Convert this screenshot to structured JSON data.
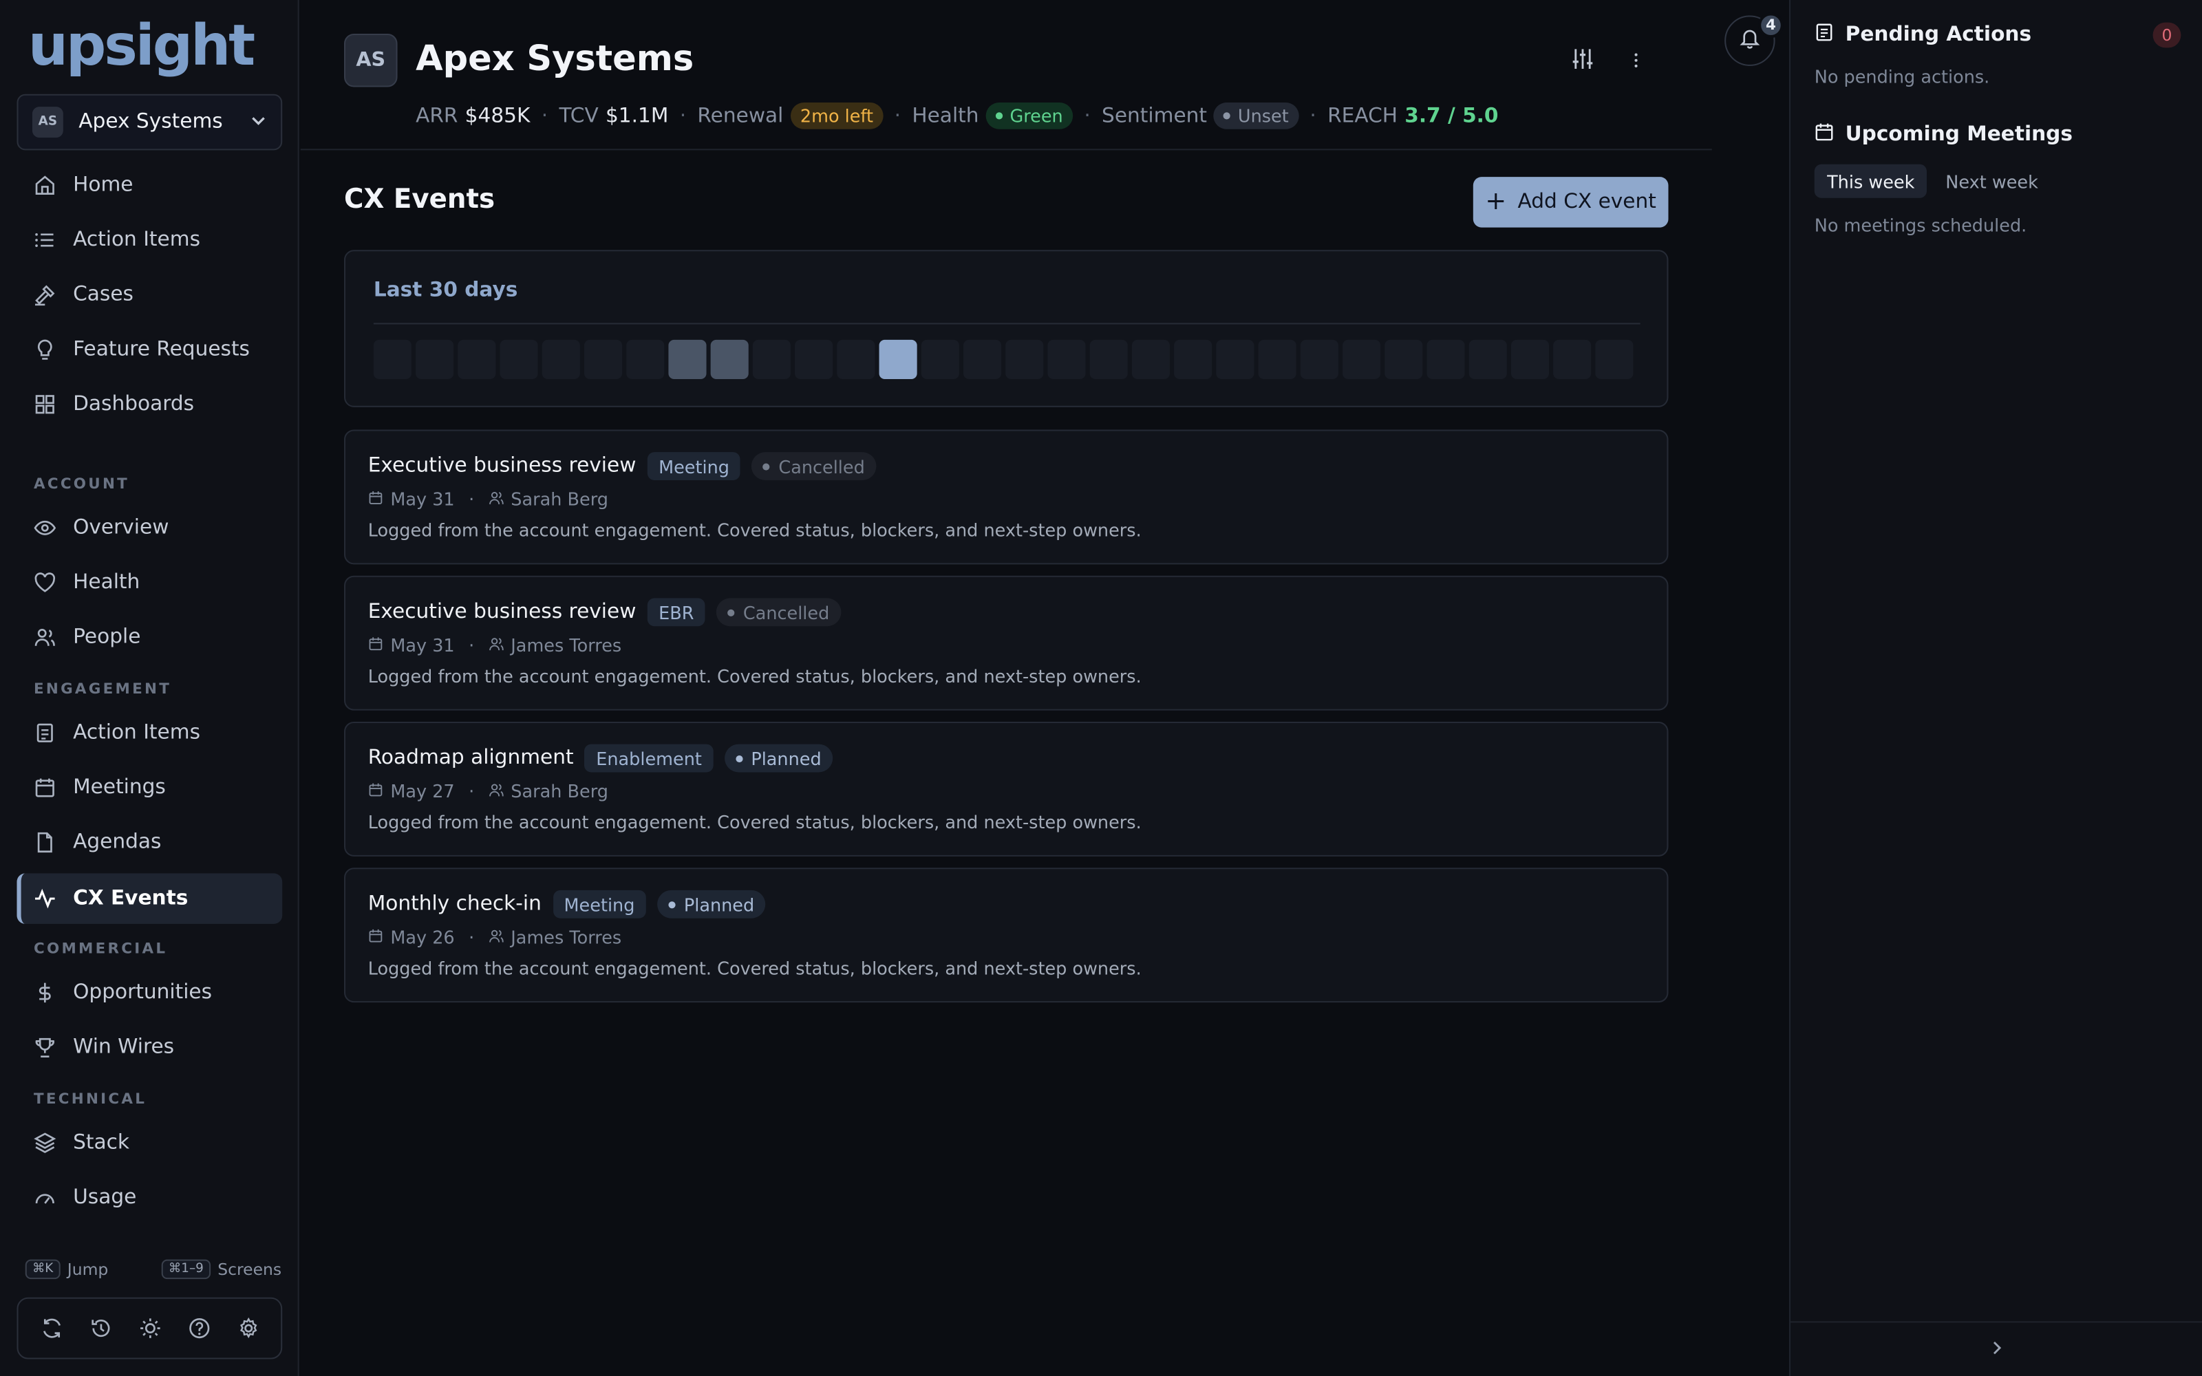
{
  "app": {
    "logo": "upsight"
  },
  "account_selector": {
    "initials": "AS",
    "name": "Apex Systems"
  },
  "nav_top": [
    {
      "label": "Home",
      "icon": "home-icon"
    },
    {
      "label": "Action Items",
      "icon": "list-icon"
    },
    {
      "label": "Cases",
      "icon": "gavel-icon"
    },
    {
      "label": "Feature Requests",
      "icon": "lightbulb-icon"
    },
    {
      "label": "Dashboards",
      "icon": "grid-icon"
    }
  ],
  "sections": {
    "account": "ACCOUNT",
    "engagement": "ENGAGEMENT",
    "commercial": "COMMERCIAL",
    "technical": "TECHNICAL"
  },
  "nav_account": [
    {
      "label": "Overview",
      "icon": "eye-icon"
    },
    {
      "label": "Health",
      "icon": "heart-icon"
    },
    {
      "label": "People",
      "icon": "users-icon"
    }
  ],
  "nav_engagement": [
    {
      "label": "Action Items",
      "icon": "clipboard-icon"
    },
    {
      "label": "Meetings",
      "icon": "calendar-icon"
    },
    {
      "label": "Agendas",
      "icon": "file-icon"
    },
    {
      "label": "CX Events",
      "icon": "activity-icon",
      "active": true
    }
  ],
  "nav_commercial": [
    {
      "label": "Opportunities",
      "icon": "dollar-icon"
    },
    {
      "label": "Win Wires",
      "icon": "trophy-icon"
    }
  ],
  "nav_technical": [
    {
      "label": "Stack",
      "icon": "layers-icon"
    },
    {
      "label": "Usage",
      "icon": "gauge-icon"
    }
  ],
  "shortcuts": {
    "jump_key": "⌘K",
    "jump_label": "Jump",
    "screens_key": "⌘1–9",
    "screens_label": "Screens"
  },
  "toolbar_icons": [
    "refresh-icon",
    "history-icon",
    "sun-icon",
    "help-icon",
    "settings-icon"
  ],
  "header": {
    "initials": "AS",
    "title": "Apex Systems",
    "arr_label": "ARR",
    "arr_value": "$485K",
    "tcv_label": "TCV",
    "tcv_value": "$1.1M",
    "renewal_label": "Renewal",
    "renewal_value": "2mo left",
    "health_label": "Health",
    "health_value": "Green",
    "sentiment_label": "Sentiment",
    "sentiment_value": "Unset",
    "reach_label": "REACH",
    "reach_value": "3.7 / 5.0",
    "notifications_count": "4"
  },
  "cx": {
    "title": "CX Events",
    "add_label": "Add CX event",
    "heatmap_title": "Last 30 days",
    "heatmap_levels": [
      0,
      0,
      0,
      0,
      0,
      0,
      0,
      1,
      1,
      0,
      0,
      0,
      3,
      0,
      0,
      0,
      0,
      0,
      0,
      0,
      0,
      0,
      0,
      0,
      0,
      0,
      0,
      0,
      0,
      0
    ],
    "events": [
      {
        "title": "Executive business review",
        "type": "Meeting",
        "status": "Cancelled",
        "status_kind": "cancelled",
        "date": "May 31",
        "owner": "Sarah Berg",
        "desc": "Logged from the account engagement. Covered status, blockers, and next-step owners."
      },
      {
        "title": "Executive business review",
        "type": "EBR",
        "status": "Cancelled",
        "status_kind": "cancelled",
        "date": "May 31",
        "owner": "James Torres",
        "desc": "Logged from the account engagement. Covered status, blockers, and next-step owners."
      },
      {
        "title": "Roadmap alignment",
        "type": "Enablement",
        "status": "Planned",
        "status_kind": "planned",
        "date": "May 27",
        "owner": "Sarah Berg",
        "desc": "Logged from the account engagement. Covered status, blockers, and next-step owners."
      },
      {
        "title": "Monthly check-in",
        "type": "Meeting",
        "status": "Planned",
        "status_kind": "planned",
        "date": "May 26",
        "owner": "James Torres",
        "desc": "Logged from the account engagement. Covered status, blockers, and next-step owners."
      }
    ]
  },
  "right_panel": {
    "pending_title": "Pending Actions",
    "pending_count": "0",
    "pending_empty": "No pending actions.",
    "meetings_title": "Upcoming Meetings",
    "tab_this_week": "This week",
    "tab_next_week": "Next week",
    "meetings_empty": "No meetings scheduled."
  },
  "colors": {
    "accent": "#8fa8cc",
    "green": "#5fd38f",
    "amber": "#f0b347",
    "danger": "#e06b78"
  }
}
